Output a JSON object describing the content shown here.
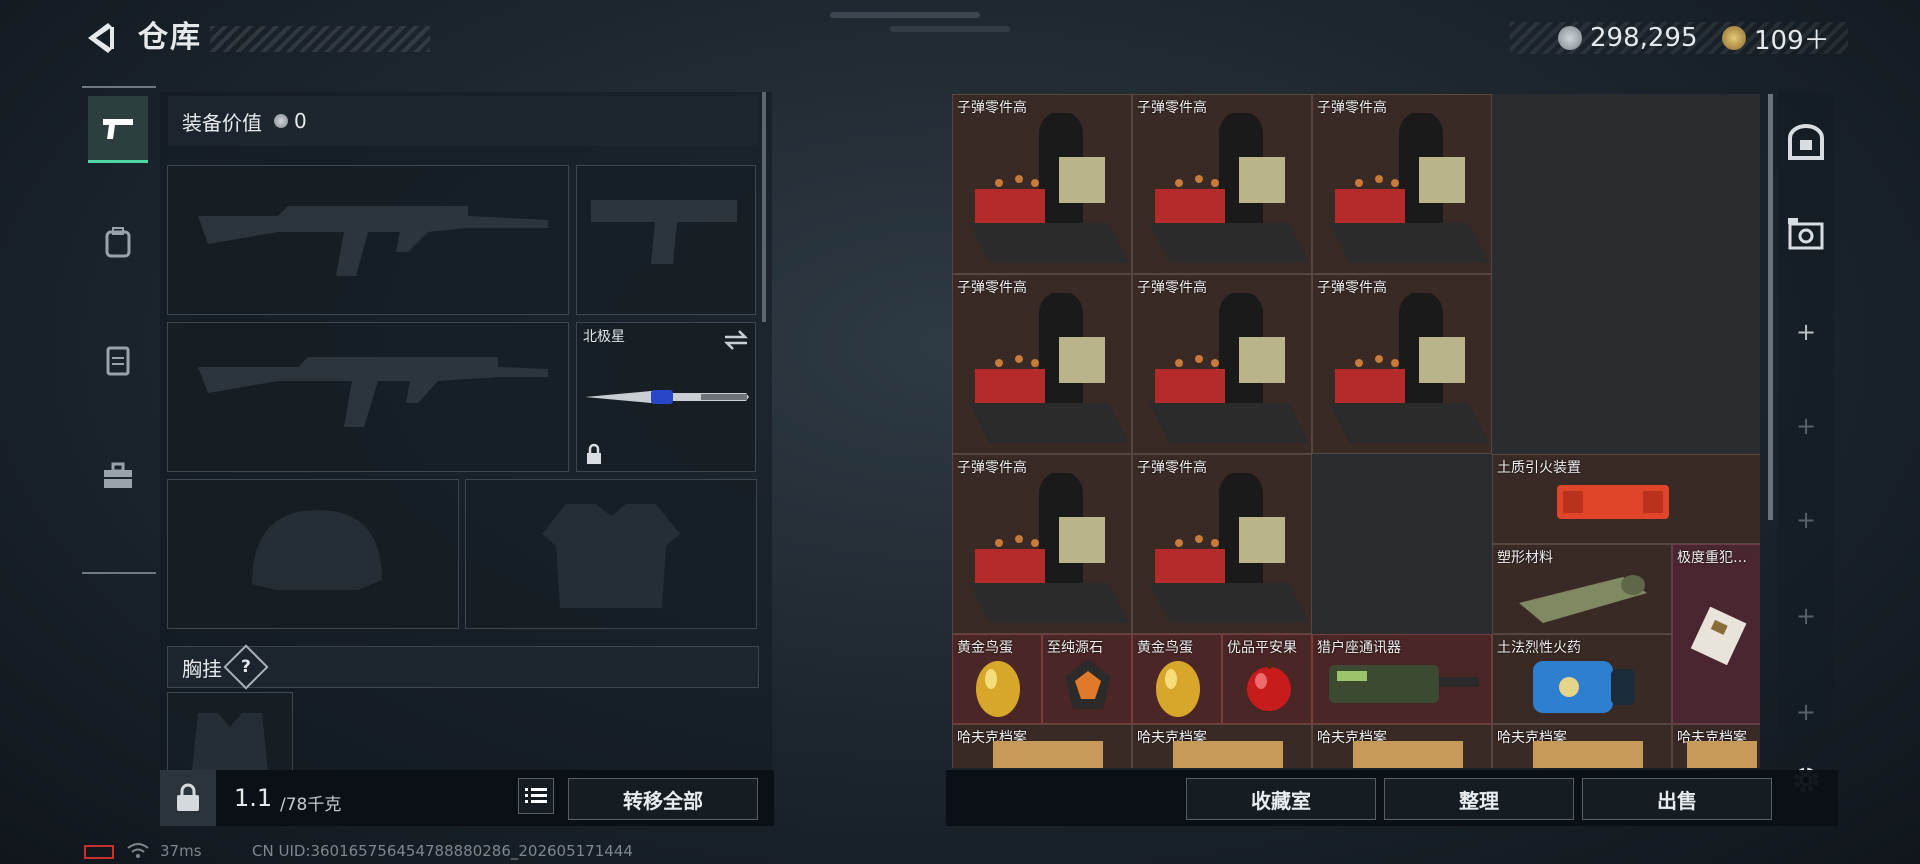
{
  "header": {
    "title": "仓库",
    "currency1": "298,295",
    "currency2": "109＋"
  },
  "equip": {
    "value_label": "装备价值",
    "value": "0",
    "knife_name": "北极星",
    "chest_label": "胸挂",
    "chest_help": "?"
  },
  "capacity": {
    "current": "1.1",
    "max": "/78千克"
  },
  "buttons": {
    "transfer_all": "转移全部",
    "collection": "收藏室",
    "organize": "整理",
    "sell": "出售"
  },
  "grid": {
    "ammo": "子弹零件高",
    "igniter": "土质引火装置",
    "plastic": "塑形材料",
    "extreme": "极度重犯…",
    "golden_egg": "黄金鸟蛋",
    "pure_stone": "至纯源石",
    "apple": "优品平安果",
    "radio": "猎户座通讯器",
    "explosive": "土法烈性火药",
    "archive": "哈夫克档案"
  },
  "status": {
    "ping": "37ms",
    "uid": "CN UID:360165756454788880286_202605171444"
  },
  "colors": {
    "accent": "#4fd6a5",
    "item_bg": "#3a2a26",
    "gold_item_bg": "#4a2626"
  }
}
